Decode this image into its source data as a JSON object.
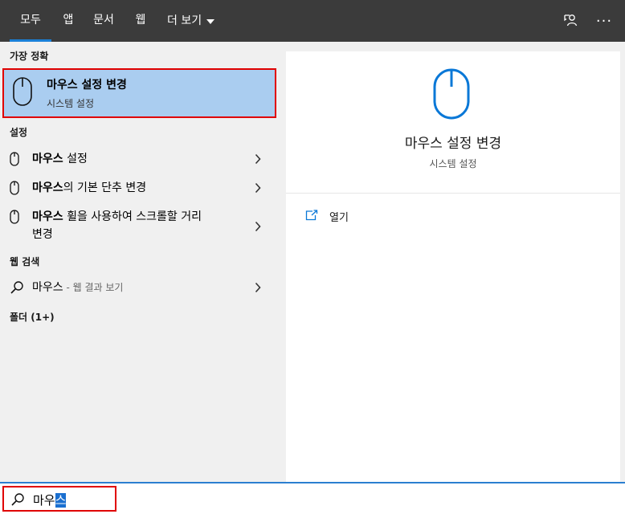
{
  "tabs": [
    {
      "label": "모두",
      "active": true
    },
    {
      "label": "앱"
    },
    {
      "label": "문서"
    },
    {
      "label": "웹"
    },
    {
      "label": "더 보기"
    }
  ],
  "icons": {
    "feedback": "feedback-icon",
    "more": "more-options-icon",
    "mouse": "mouse-icon",
    "chevron": "chevron-right-icon",
    "search": "search-icon",
    "open": "open-icon"
  },
  "top_right": {
    "more_glyph": "···"
  },
  "colors": {
    "topbar": "#3b3b3b",
    "accent": "#1a80d8",
    "best_match_bg": "#aacdf0",
    "highlight_border": "#e00000",
    "icon_blue": "#0a78d7"
  },
  "left": {
    "best_match_header": "가장 정확",
    "best_match": {
      "title": "마우스 설정 변경",
      "subtitle": "시스템 설정"
    },
    "settings_header": "설정",
    "settings": [
      {
        "bold": "마우스",
        "rest": " 설정"
      },
      {
        "bold": "마우스",
        "rest": "의 기본 단추 변경"
      },
      {
        "bold": "마우스",
        "rest": " 휠을 사용하여 스크롤할 거리",
        "line2": "변경"
      }
    ],
    "web_header": "웹 검색",
    "web": {
      "query": "마우스",
      "suffix": " - 웹 결과 보기"
    },
    "folders_header": "폴더 (1+)"
  },
  "preview": {
    "title": "마우스 설정 변경",
    "subtitle": "시스템 설정",
    "open_label": "열기"
  },
  "search": {
    "typed": "마우",
    "selected": "스"
  }
}
